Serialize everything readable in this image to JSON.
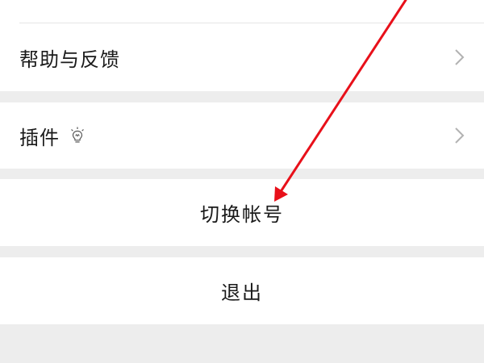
{
  "settings": {
    "help_label": "帮助与反馈",
    "plugins_label": "插件",
    "switch_account_label": "切换帐号",
    "logout_label": "退出"
  },
  "icons": {
    "chevron": "chevron-right-icon",
    "bulb": "lightbulb-icon"
  },
  "colors": {
    "background": "#ededed",
    "card": "#ffffff",
    "text": "#1a1a1a",
    "chevron": "#b2b2b2",
    "annotation_arrow": "#e8101a"
  }
}
